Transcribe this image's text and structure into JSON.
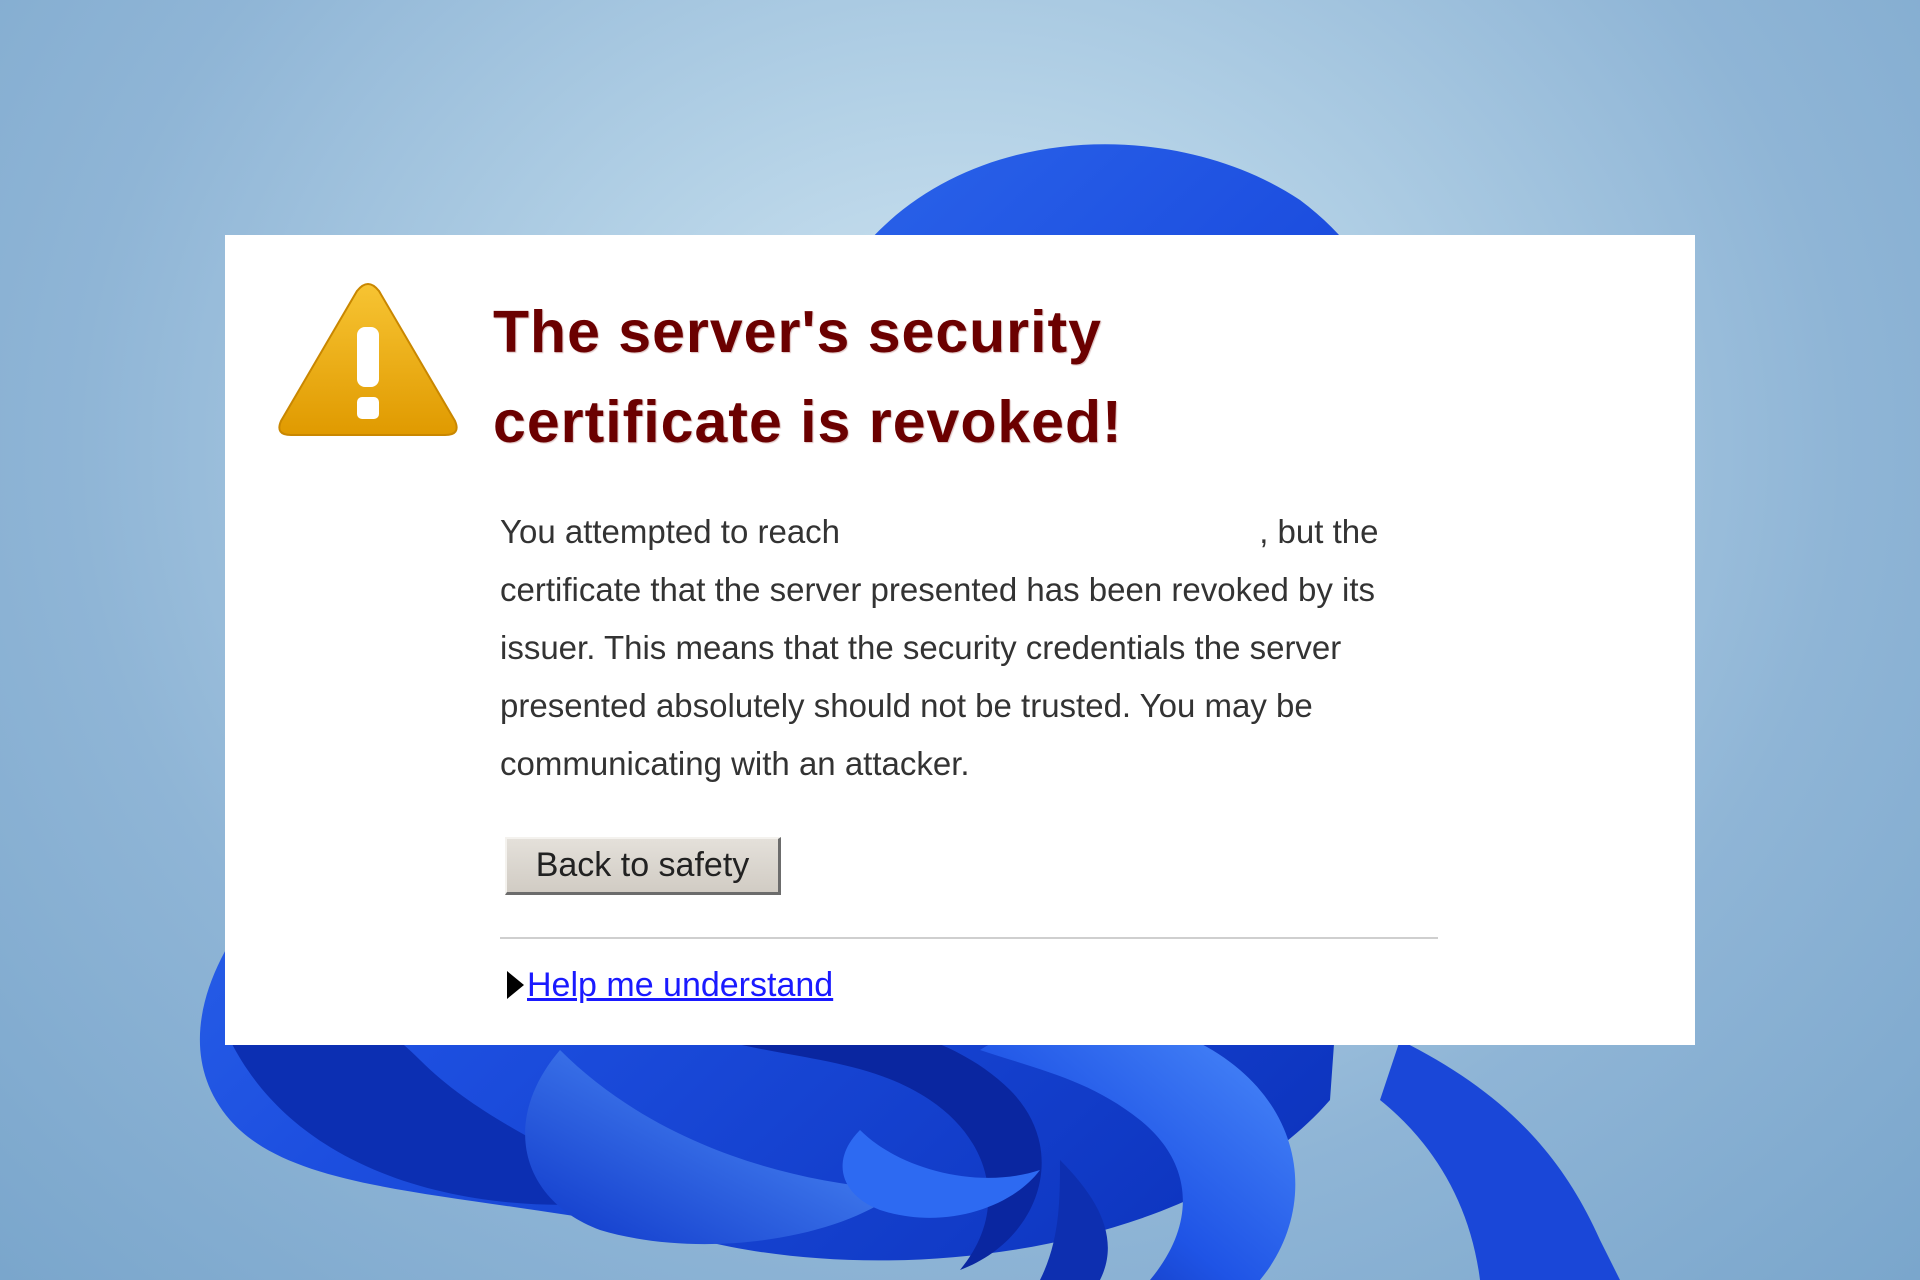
{
  "theme": {
    "headline_color": "#6b0000",
    "link_color": "#1a1aff",
    "wallpaper_blue": "#1f4fe0"
  },
  "error_page": {
    "icon": "warning-triangle-icon",
    "headline_line1": "The server's security",
    "headline_line2": "certificate is revoked!",
    "body_start": "You attempted to reach",
    "body_rest": ", but the certificate that the server presented has been revoked by its issuer. This means that the security credentials the server presented absolutely should not be trusted. You may be communicating with an attacker.",
    "back_button_label": "Back to safety",
    "help_expander_icon": "triangle-right-icon",
    "help_link_label": "Help me understand"
  }
}
